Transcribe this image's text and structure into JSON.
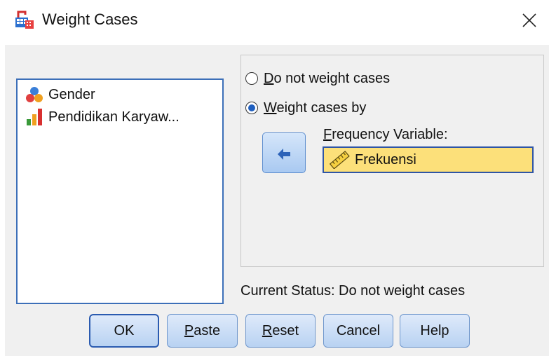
{
  "window": {
    "title": "Weight Cases",
    "icons": {
      "app": "spss-weight-cases-icon",
      "close": "close-icon"
    }
  },
  "variables": [
    {
      "label": "Gender",
      "icon": "nominal-variable-icon"
    },
    {
      "label": "Pendidikan Karyaw...",
      "icon": "ordinal-variable-icon"
    }
  ],
  "weighting": {
    "options": [
      {
        "label": "Do not weight cases",
        "checked": false
      },
      {
        "label": "Weight cases by",
        "checked": true
      }
    ],
    "move_button_icon": "arrow-left-icon",
    "frequency_label": "Frequency Variable:",
    "frequency_value": "Frekuensi",
    "frequency_value_icon": "scale-variable-icon"
  },
  "status": "Current Status: Do not weight cases",
  "buttons": {
    "ok": "OK",
    "paste": "Paste",
    "reset": "Reset",
    "cancel": "Cancel",
    "help": "Help"
  },
  "colors": {
    "selected_field": "#fce07a",
    "focus_border": "#2f55a5",
    "button_gradient_top": "#dfeafa",
    "button_gradient_bottom": "#b8d2f2"
  }
}
